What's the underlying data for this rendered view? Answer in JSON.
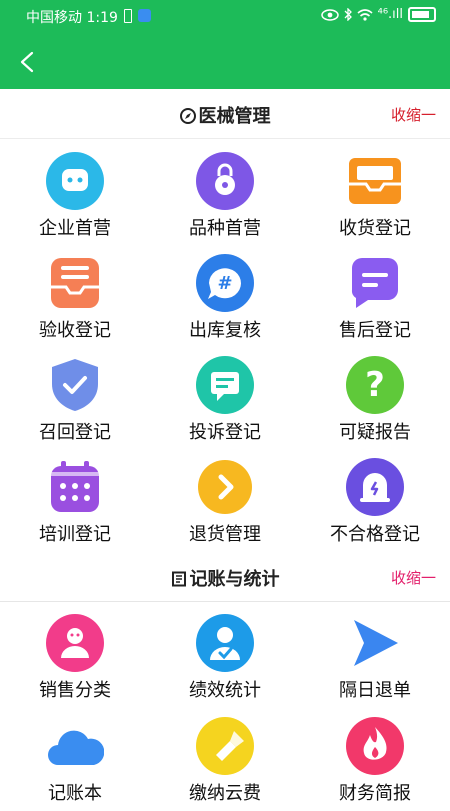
{
  "status_bar": {
    "carrier_time": "中国移动 1:19",
    "network": "⁴⁶.ıll"
  },
  "sections": [
    {
      "title": "医械管理",
      "toggle": "收缩一",
      "items": [
        {
          "label": "企业首营",
          "icon": "chat-bubble-icon",
          "color": "#2bb8e8"
        },
        {
          "label": "品种首营",
          "icon": "padlock-icon",
          "color": "#7e57e6"
        },
        {
          "label": "收货登记",
          "icon": "inbox-tray-icon",
          "color": "#f7931e"
        },
        {
          "label": "验收登记",
          "icon": "checklist-tray-icon",
          "color": "#f57f55"
        },
        {
          "label": "出库复核",
          "icon": "hashtag-chat-icon",
          "color": "#2c7ee8"
        },
        {
          "label": "售后登记",
          "icon": "message-lines-icon",
          "color": "#8a5cf0"
        },
        {
          "label": "召回登记",
          "icon": "shield-check-icon",
          "color": "#6f8ee8"
        },
        {
          "label": "投诉登记",
          "icon": "message-doc-icon",
          "color": "#1fc5a8"
        },
        {
          "label": "可疑报告",
          "icon": "question-icon",
          "color": "#5fc93a"
        },
        {
          "label": "培训登记",
          "icon": "calendar-icon",
          "color": "#9a4fe0"
        },
        {
          "label": "退货管理",
          "icon": "arrow-right-icon",
          "color": "#f7b820"
        },
        {
          "label": "不合格登记",
          "icon": "alarm-bell-icon",
          "color": "#6a4fe0"
        }
      ]
    },
    {
      "title": "记账与统计",
      "toggle": "收缩一",
      "items": [
        {
          "label": "销售分类",
          "icon": "person-icon",
          "color": "#f23c8a"
        },
        {
          "label": "绩效统计",
          "icon": "person-check-icon",
          "color": "#1d9be8"
        },
        {
          "label": "隔日退单",
          "icon": "send-arrow-icon",
          "color": "#3a86f0"
        },
        {
          "label": "记账本",
          "icon": "cloud-icon",
          "color": "#3a8df0"
        },
        {
          "label": "缴纳云费",
          "icon": "flashlight-icon",
          "color": "#f5d41f"
        },
        {
          "label": "财务简报",
          "icon": "flame-icon",
          "color": "#f2386a"
        }
      ]
    }
  ]
}
